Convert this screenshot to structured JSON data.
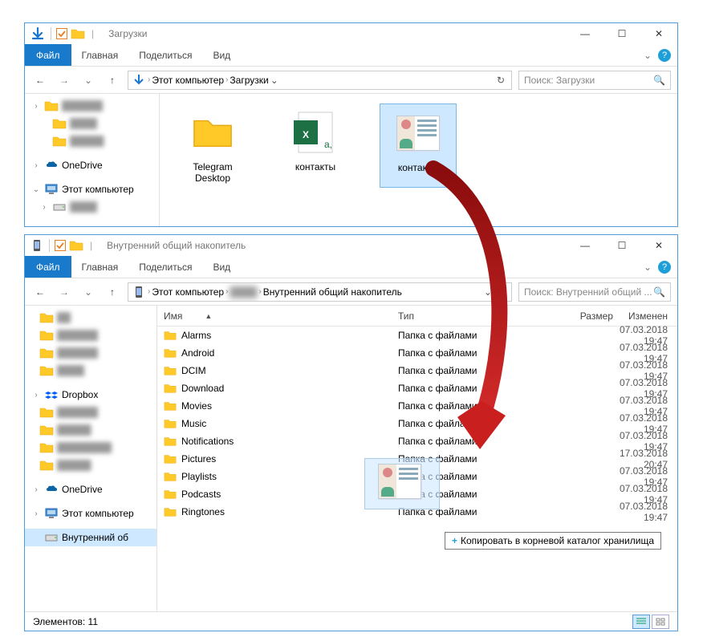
{
  "window1": {
    "title": "Загрузки",
    "ribbon": {
      "file": "Файл",
      "home": "Главная",
      "share": "Поделиться",
      "view": "Вид"
    },
    "breadcrumbs": [
      "Этот компьютер",
      "Загрузки"
    ],
    "search_placeholder": "Поиск: Загрузки",
    "tree": [
      {
        "label": "",
        "icon": "folder",
        "blur": true,
        "sync": true
      },
      {
        "label": "",
        "icon": "folder",
        "blur": true,
        "sync": true
      },
      {
        "label": "",
        "icon": "folder",
        "blur": true,
        "sync": true
      },
      {
        "label": "OneDrive",
        "icon": "onedrive",
        "expandable": true
      },
      {
        "label": "Этот компьютер",
        "icon": "pc",
        "expandable": true,
        "expanded": true
      },
      {
        "label": "",
        "icon": "drive",
        "blur": true,
        "expandable": true
      }
    ],
    "grid_items": [
      {
        "label": "Telegram Desktop",
        "icon": "folder"
      },
      {
        "label": "контакты",
        "icon": "excel"
      },
      {
        "label": "контакты",
        "icon": "contact",
        "selected": true
      }
    ]
  },
  "window2": {
    "title": "Внутренний общий накопитель",
    "ribbon": {
      "file": "Файл",
      "home": "Главная",
      "share": "Поделиться",
      "view": "Вид"
    },
    "breadcrumbs": [
      "Этот компьютер",
      "",
      "Внутренний общий накопитель"
    ],
    "search_placeholder": "Поиск: Внутренний общий ...",
    "columns": {
      "name": "Имя",
      "type": "Тип",
      "size": "Размер",
      "modified": "Изменен"
    },
    "tree": [
      {
        "label": "",
        "icon": "folder",
        "blur": true
      },
      {
        "label": "",
        "icon": "folder",
        "blur": true,
        "sync": true
      },
      {
        "label": "",
        "icon": "folder",
        "blur": true,
        "sync": true
      },
      {
        "label": "",
        "icon": "folder",
        "blur": true
      },
      {
        "label": "Dropbox",
        "icon": "dropbox",
        "expandable": true
      },
      {
        "label": "",
        "icon": "folder",
        "blur": true,
        "sync": true
      },
      {
        "label": "",
        "icon": "folder",
        "blur": true,
        "sync": true
      },
      {
        "label": "",
        "icon": "folder",
        "blur": true,
        "sync": true
      },
      {
        "label": "",
        "icon": "folder",
        "blur": true,
        "sync": true
      },
      {
        "label": "OneDrive",
        "icon": "onedrive",
        "expandable": true
      },
      {
        "label": "Этот компьютер",
        "icon": "pc",
        "expandable": true
      },
      {
        "label": "Внутренний об",
        "icon": "drive",
        "selected": true
      }
    ],
    "rows": [
      {
        "name": "Alarms",
        "type": "Папка с файлами",
        "modified": "07.03.2018 19:47"
      },
      {
        "name": "Android",
        "type": "Папка с файлами",
        "modified": "07.03.2018 19:47"
      },
      {
        "name": "DCIM",
        "type": "Папка с файлами",
        "modified": "07.03.2018 19:47"
      },
      {
        "name": "Download",
        "type": "Папка с файлами",
        "modified": "07.03.2018 19:47"
      },
      {
        "name": "Movies",
        "type": "Папка с файлами",
        "modified": "07.03.2018 19:47"
      },
      {
        "name": "Music",
        "type": "Папка с файлами",
        "modified": "07.03.2018 19:47"
      },
      {
        "name": "Notifications",
        "type": "Папка с файлами",
        "modified": "07.03.2018 19:47"
      },
      {
        "name": "Pictures",
        "type": "Папка с файлами",
        "modified": "17.03.2018 20:47"
      },
      {
        "name": "Playlists",
        "type": "Папка с файлами",
        "modified": "07.03.2018 19:47"
      },
      {
        "name": "Podcasts",
        "type": "Папка с файлами",
        "modified": "07.03.2018 19:47"
      },
      {
        "name": "Ringtones",
        "type": "Папка с файлами",
        "modified": "07.03.2018 19:47"
      }
    ],
    "drop_tip": "Копировать в корневой каталог хранилища",
    "status": "Элементов: 11"
  }
}
